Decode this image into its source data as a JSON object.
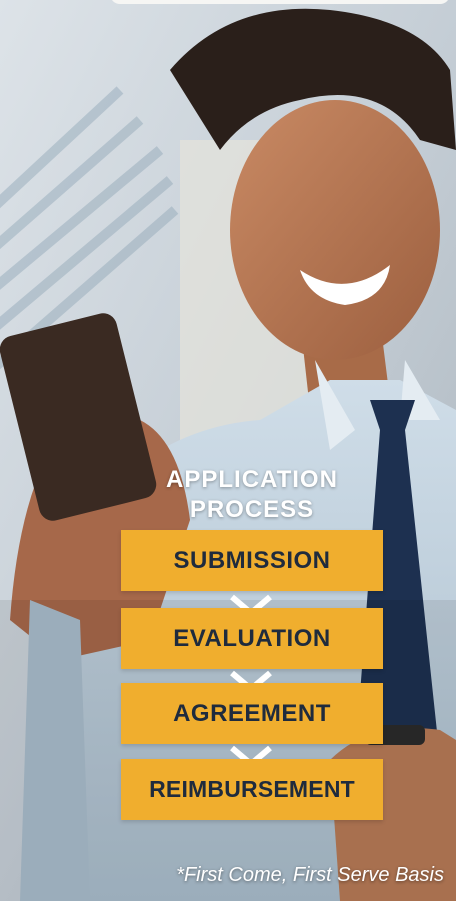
{
  "process": {
    "heading_line1": "APPLICATION",
    "heading_line2": "PROCESS",
    "steps": [
      "SUBMISSION",
      "EVALUATION",
      "AGREEMENT",
      "REIMBURSEMENT"
    ]
  },
  "footnote": "*First Come, First Serve Basis",
  "colors": {
    "step_fill": "#f0ae2e",
    "step_text": "#1f2b3d",
    "heading_text": "#ffffff",
    "chevron": "#ffffff"
  },
  "icons": {
    "chevron": "chevron-down-icon"
  }
}
